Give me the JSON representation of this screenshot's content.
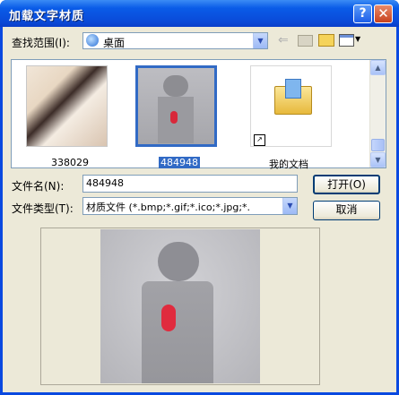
{
  "window": {
    "title": "加载文字材质",
    "help_glyph": "?",
    "close_glyph": "✕"
  },
  "lookin": {
    "label": "查找范围(I):",
    "value": "桌面"
  },
  "toolbar": {
    "back_icon": "back-arrow-icon",
    "up_icon": "up-folder-icon",
    "newfolder_icon": "new-folder-icon",
    "view_icon": "view-menu-icon"
  },
  "files": [
    {
      "name": "338029",
      "selected": false
    },
    {
      "name": "484948",
      "selected": true
    },
    {
      "name": "我的文档",
      "selected": false
    }
  ],
  "filename": {
    "label": "文件名(N):",
    "value": "484948"
  },
  "filetype": {
    "label": "文件类型(T):",
    "value": "材质文件 (*.bmp;*.gif;*.ico;*.jpg;*."
  },
  "buttons": {
    "open": "打开(O)",
    "cancel": "取消"
  },
  "colors": {
    "titlebar": "#0a5ce8",
    "face": "#ece9d8",
    "selection": "#316ac5"
  }
}
